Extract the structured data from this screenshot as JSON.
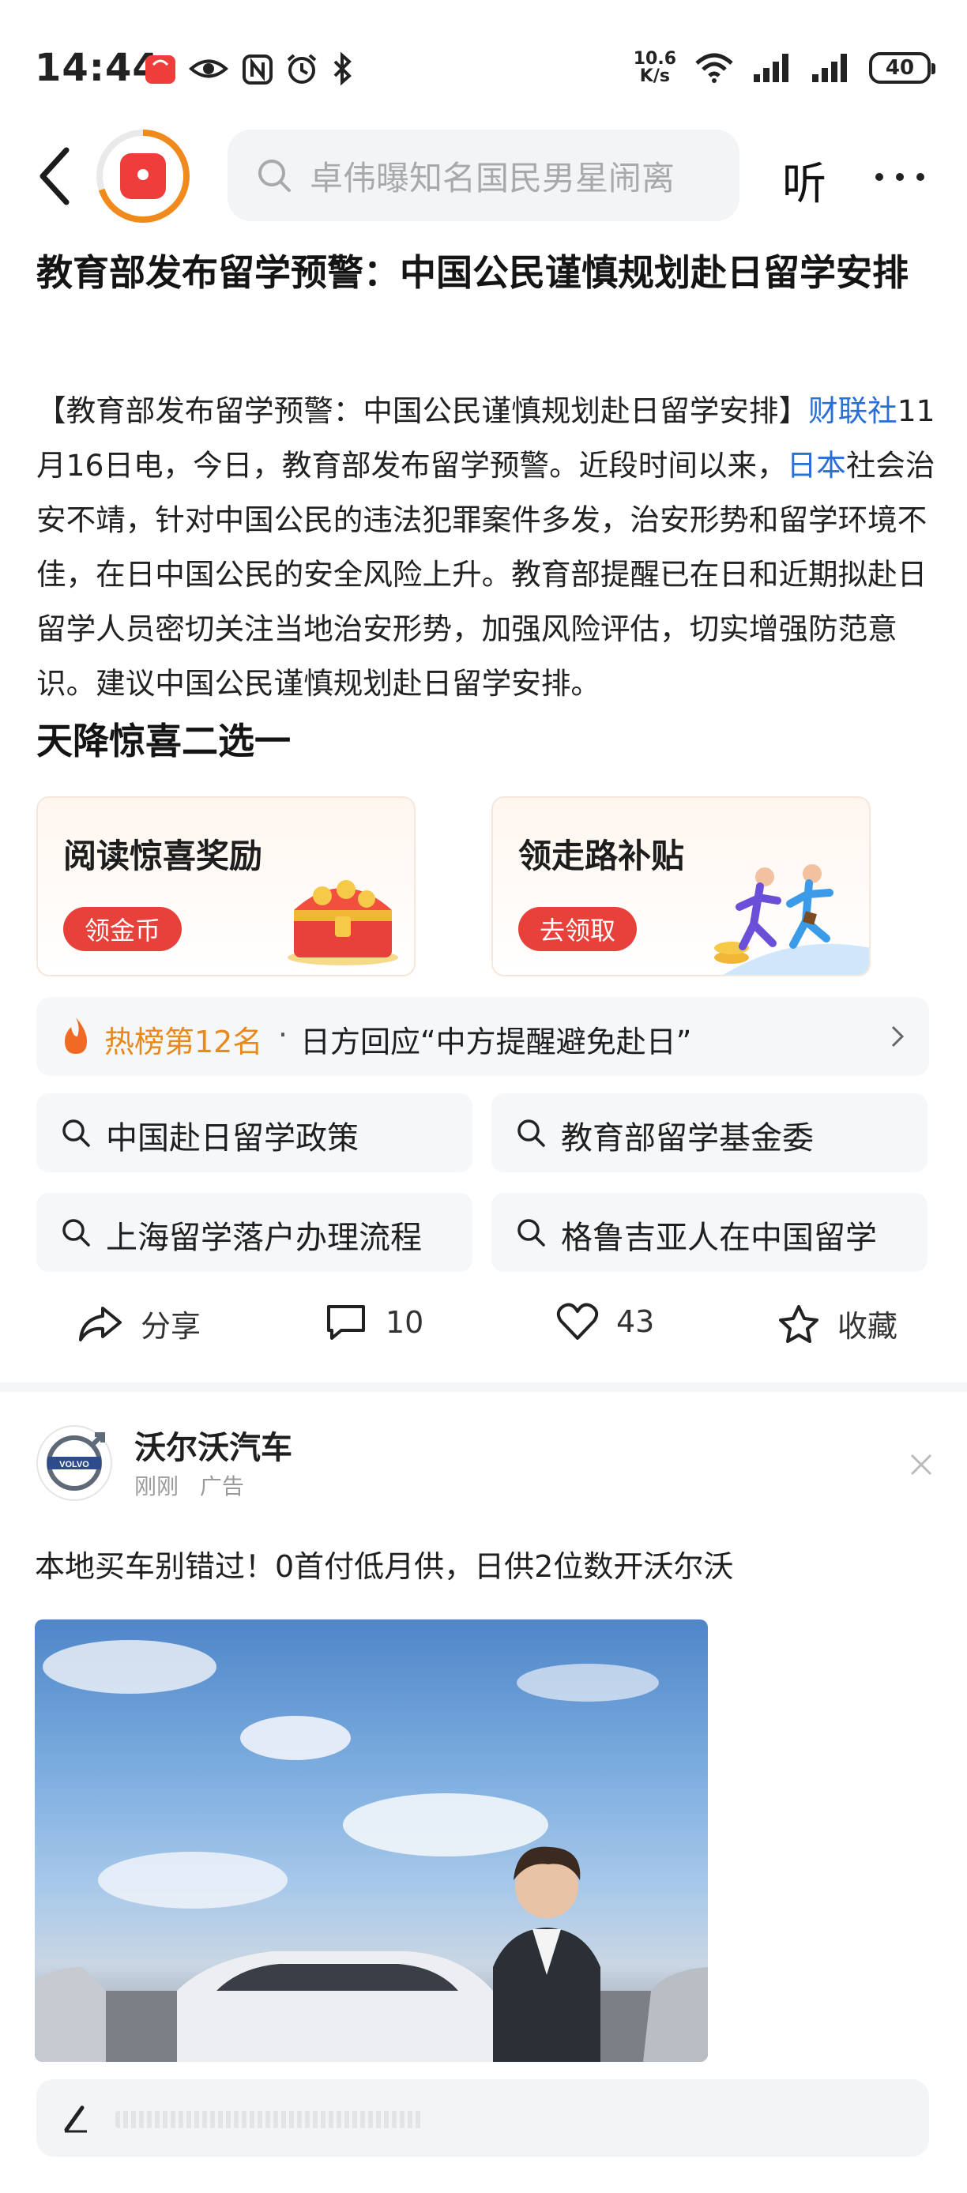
{
  "status_bar": {
    "time": "14:44",
    "net_speed_value": "10.6",
    "net_speed_unit": "K/s",
    "battery": "40"
  },
  "top_bar": {
    "search_placeholder": "卓伟曝知名国民男星闹离",
    "listen_label": "听"
  },
  "article": {
    "headline": "教育部发布留学预警：中国公民谨慎规划赴日留学安排",
    "body": {
      "part1": "【教育部发布留学预警：中国公民谨慎规划赴日留学安排】",
      "link1": "财联社",
      "part2": "11月16日电，今日，教育部发布留学预警。近段时间以来，",
      "link2": "日本",
      "part3": "社会治安不靖，针对中国公民的违法犯罪案件多发，治安形势和留学环境不佳，在日中国公民的安全风险上升。教育部提醒已在日和近期拟赴日留学人员密切关注当地治安形势，加强风险评估，切实增强防范意识。建议中国公民谨慎规划赴日留学安排。"
    }
  },
  "promo": {
    "section_title": "天降惊喜二选一",
    "cards": [
      {
        "title": "阅读惊喜奖励",
        "button": "领金币"
      },
      {
        "title": "领走路补贴",
        "button": "去领取"
      }
    ]
  },
  "hot_list": {
    "rank": "热榜第12名",
    "separator": "·",
    "title": "日方回应“中方提醒避免赴日”"
  },
  "related_searches": [
    "中国赴日留学政策",
    "教育部留学基金委",
    "上海留学落户办理流程",
    "格鲁吉亚人在中国留学"
  ],
  "actions": {
    "share": "分享",
    "comments": "10",
    "likes": "43",
    "favorite": "收藏"
  },
  "ad": {
    "advertiser": "沃尔沃汽车",
    "logo_text": "VOLVO",
    "time": "刚刚",
    "label": "广告",
    "text": "本地买车别错过！0首付低月供，日供2位数开沃尔沃"
  },
  "colors": {
    "accent_orange": "#e9891c",
    "link_blue": "#2a6fd6",
    "button_red": "#e8413c"
  }
}
